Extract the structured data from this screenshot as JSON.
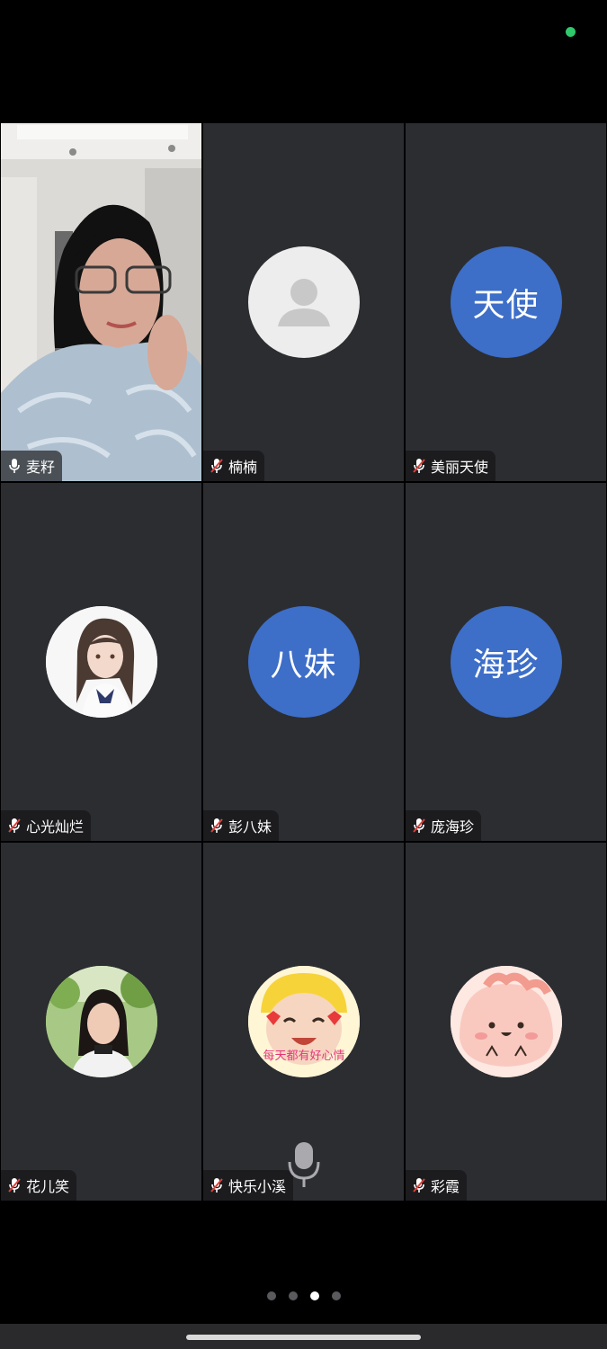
{
  "status": {
    "indicator_color": "#2fc86b"
  },
  "participants": [
    {
      "name": "麦籽",
      "mic": "on",
      "type": "video"
    },
    {
      "name": "楠楠",
      "mic": "muted",
      "type": "placeholder"
    },
    {
      "name": "美丽天使",
      "mic": "muted",
      "type": "initials",
      "initials": "天使",
      "color": "#3d6ec8"
    },
    {
      "name": "心光灿烂",
      "mic": "muted",
      "type": "photo",
      "icon": "anime-girl-avatar"
    },
    {
      "name": "彭八妹",
      "mic": "muted",
      "type": "initials",
      "initials": "八妹",
      "color": "#3d6ec8"
    },
    {
      "name": "庞海珍",
      "mic": "muted",
      "type": "initials",
      "initials": "海珍",
      "color": "#3d6ec8"
    },
    {
      "name": "花儿笑",
      "mic": "muted",
      "type": "photo",
      "icon": "woman-portrait-avatar"
    },
    {
      "name": "快乐小溪",
      "mic": "muted",
      "type": "photo",
      "icon": "baby-sticker-avatar",
      "caption": "每天都有好心情"
    },
    {
      "name": "彩霞",
      "mic": "muted",
      "type": "photo",
      "icon": "pink-cartoon-avatar"
    }
  ],
  "pager": {
    "pages": 4,
    "current": 3
  },
  "colors": {
    "tile_bg": "#2b2d31",
    "muted_red": "#e0403a",
    "accent_blue": "#3d6ec8"
  }
}
